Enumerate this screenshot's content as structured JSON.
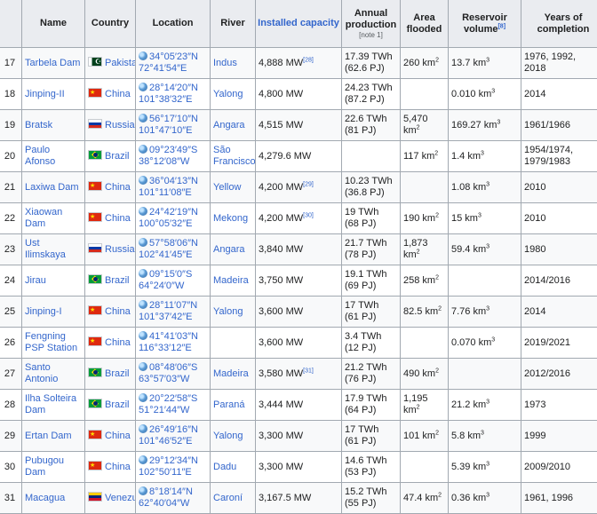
{
  "headers": {
    "rank": "",
    "name": "Name",
    "country": "Country",
    "location": "Location",
    "river": "River",
    "capacity": "Installed capacity",
    "production": "Annual production",
    "production_note": "[note 1]",
    "area": "Area flooded",
    "reservoir": "Reservoir volume",
    "reservoir_ref": "[8]",
    "years": "Years of completion"
  },
  "rows": [
    {
      "rank": "17",
      "name": "Tarbela Dam",
      "flag": "pk",
      "country": "Pakistan",
      "lat": "34°05′23″N",
      "lon": "72°41′54″E",
      "river": "Indus",
      "capacity": "4,888 MW",
      "cap_ref": "[28]",
      "prod1": "17.39 TWh",
      "prod2": "(62.6 PJ)",
      "area": "260 km",
      "area_sup": "2",
      "reservoir": "13.7 km",
      "res_sup": "3",
      "years1": "1976, 1992,",
      "years2": "2018"
    },
    {
      "rank": "18",
      "name": "Jinping-II",
      "flag": "cn",
      "country": "China",
      "lat": "28°14′20″N",
      "lon": "101°38′32″E",
      "river": "Yalong",
      "capacity": "4,800 MW",
      "cap_ref": "",
      "prod1": "24.23 TWh",
      "prod2": "(87.2 PJ)",
      "area": "",
      "area_sup": "",
      "reservoir": "0.010 km",
      "res_sup": "3",
      "years1": "2014",
      "years2": ""
    },
    {
      "rank": "19",
      "name": "Bratsk",
      "flag": "ru",
      "country": "Russia",
      "lat": "56°17′10″N",
      "lon": "101°47′10″E",
      "river": "Angara",
      "capacity": "4,515 MW",
      "cap_ref": "",
      "prod1": "22.6 TWh",
      "prod2": "(81 PJ)",
      "area": "5,470 km",
      "area_sup": "2",
      "reservoir": "169.27 km",
      "res_sup": "3",
      "years1": "1961/1966",
      "years2": ""
    },
    {
      "rank": "20",
      "name": "Paulo Afonso",
      "flag": "br",
      "country": "Brazil",
      "lat": "09°23′49″S",
      "lon": "38°12′08″W",
      "river": "São Francisco",
      "capacity": "4,279.6 MW",
      "cap_ref": "",
      "prod1": "",
      "prod2": "",
      "area": "117 km",
      "area_sup": "2",
      "reservoir": "1.4 km",
      "res_sup": "3",
      "years1": "1954/1974,",
      "years2": "1979/1983"
    },
    {
      "rank": "21",
      "name": "Laxiwa Dam",
      "flag": "cn",
      "country": "China",
      "lat": "36°04′13″N",
      "lon": "101°11′08″E",
      "river": "Yellow",
      "capacity": "4,200 MW",
      "cap_ref": "[29]",
      "prod1": "10.23 TWh",
      "prod2": "(36.8 PJ)",
      "area": "",
      "area_sup": "",
      "reservoir": "1.08 km",
      "res_sup": "3",
      "years1": "2010",
      "years2": ""
    },
    {
      "rank": "22",
      "name": "Xiaowan Dam",
      "flag": "cn",
      "country": "China",
      "lat": "24°42′19″N",
      "lon": "100°05′32″E",
      "river": "Mekong",
      "capacity": "4,200 MW",
      "cap_ref": "[30]",
      "prod1": "19 TWh",
      "prod2": "(68 PJ)",
      "area": "190 km",
      "area_sup": "2",
      "reservoir": "15 km",
      "res_sup": "3",
      "years1": "2010",
      "years2": ""
    },
    {
      "rank": "23",
      "name": "Ust Ilimskaya",
      "flag": "ru",
      "country": "Russia",
      "lat": "57°58′06″N",
      "lon": "102°41′45″E",
      "river": "Angara",
      "capacity": "3,840 MW",
      "cap_ref": "",
      "prod1": "21.7 TWh",
      "prod2": "(78 PJ)",
      "area": "1,873 km",
      "area_sup": "2",
      "reservoir": "59.4 km",
      "res_sup": "3",
      "years1": "1980",
      "years2": ""
    },
    {
      "rank": "24",
      "name": "Jirau",
      "flag": "br",
      "country": "Brazil",
      "lat": "09°15′0″S",
      "lon": "64°24′0″W",
      "river": "Madeira",
      "capacity": "3,750 MW",
      "cap_ref": "",
      "prod1": "19.1 TWh",
      "prod2": "(69 PJ)",
      "area": "258 km",
      "area_sup": "2",
      "reservoir": "",
      "res_sup": "",
      "years1": "2014/2016",
      "years2": ""
    },
    {
      "rank": "25",
      "name": "Jinping-I",
      "flag": "cn",
      "country": "China",
      "lat": "28°11′07″N",
      "lon": "101°37′42″E",
      "river": "Yalong",
      "capacity": "3,600 MW",
      "cap_ref": "",
      "prod1": "17 TWh",
      "prod2": "(61 PJ)",
      "area": "82.5 km",
      "area_sup": "2",
      "reservoir": "7.76 km",
      "res_sup": "3",
      "years1": "2014",
      "years2": ""
    },
    {
      "rank": "26",
      "name": "Fengning PSP Station",
      "flag": "cn",
      "country": "China",
      "lat": "41°41′03″N",
      "lon": "116°33′12″E",
      "river": "",
      "capacity": "3,600 MW",
      "cap_ref": "",
      "prod1": "3.4 TWh",
      "prod2": "(12 PJ)",
      "area": "",
      "area_sup": "",
      "reservoir": "0.070 km",
      "res_sup": "3",
      "years1": "2019/2021",
      "years2": ""
    },
    {
      "rank": "27",
      "name": "Santo Antonio",
      "flag": "br",
      "country": "Brazil",
      "lat": "08°48′06″S",
      "lon": "63°57′03″W",
      "river": "Madeira",
      "capacity": "3,580 MW",
      "cap_ref": "[31]",
      "prod1": "21.2 TWh",
      "prod2": "(76 PJ)",
      "area": "490 km",
      "area_sup": "2",
      "reservoir": "",
      "res_sup": "",
      "years1": "2012/2016",
      "years2": ""
    },
    {
      "rank": "28",
      "name": "Ilha Solteira Dam",
      "flag": "br",
      "country": "Brazil",
      "lat": "20°22′58″S",
      "lon": "51°21′44″W",
      "river": "Paraná",
      "capacity": "3,444 MW",
      "cap_ref": "",
      "prod1": "17.9 TWh",
      "prod2": "(64 PJ)",
      "area": "1,195 km",
      "area_sup": "2",
      "reservoir": "21.2 km",
      "res_sup": "3",
      "years1": "1973",
      "years2": ""
    },
    {
      "rank": "29",
      "name": "Ertan Dam",
      "flag": "cn",
      "country": "China",
      "lat": "26°49′16″N",
      "lon": "101°46′52″E",
      "river": "Yalong",
      "capacity": "3,300 MW",
      "cap_ref": "",
      "prod1": "17 TWh",
      "prod2": "(61 PJ)",
      "area": "101 km",
      "area_sup": "2",
      "reservoir": "5.8 km",
      "res_sup": "3",
      "years1": "1999",
      "years2": ""
    },
    {
      "rank": "30",
      "name": "Pubugou Dam",
      "flag": "cn",
      "country": "China",
      "lat": "29°12′34″N",
      "lon": "102°50′11″E",
      "river": "Dadu",
      "capacity": "3,300 MW",
      "cap_ref": "",
      "prod1": "14.6 TWh",
      "prod2": "(53 PJ)",
      "area": "",
      "area_sup": "",
      "reservoir": "5.39 km",
      "res_sup": "3",
      "years1": "2009/2010",
      "years2": ""
    },
    {
      "rank": "31",
      "name": "Macagua",
      "flag": "ve",
      "country": "Venezuela",
      "lat": "8°18′14″N",
      "lon": "62°40′04″W",
      "river": "Caroní",
      "capacity": "3,167.5 MW",
      "cap_ref": "",
      "prod1": "15.2 TWh",
      "prod2": "(55 PJ)",
      "area": "47.4 km",
      "area_sup": "2",
      "reservoir": "0.36 km",
      "res_sup": "3",
      "years1": "1961, 1996",
      "years2": ""
    }
  ]
}
